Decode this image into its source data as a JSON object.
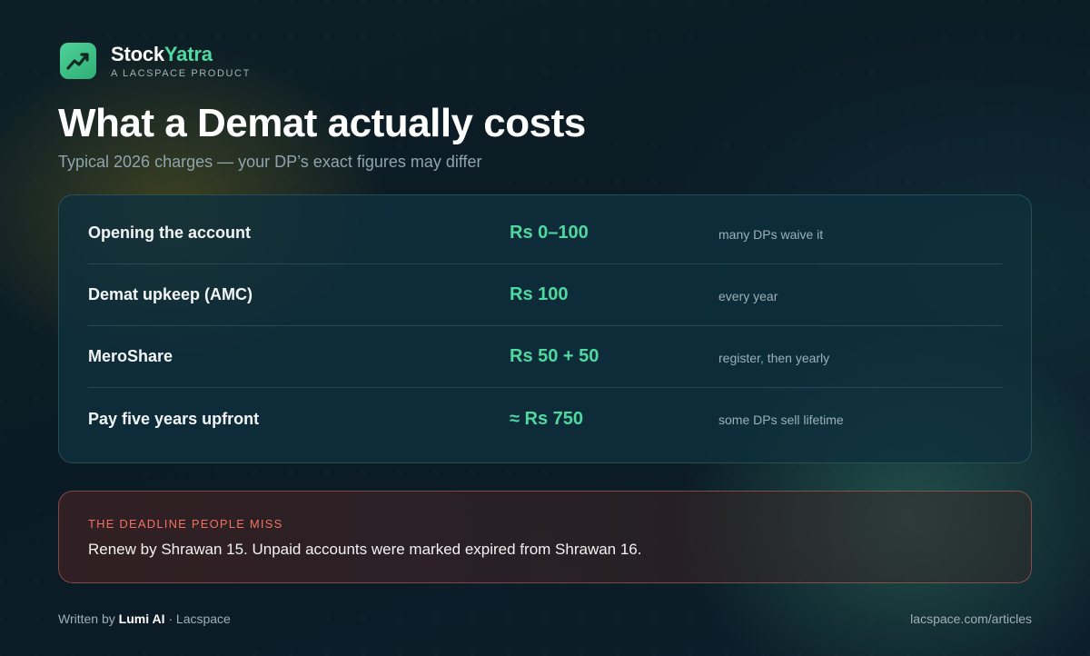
{
  "brand": {
    "name_part1": "Stock",
    "name_part2": "Yatra",
    "tagline": "A LACSPACE PRODUCT",
    "icon": "trend-up-icon",
    "accent_color": "#4fd9a0"
  },
  "title": "What a Demat actually costs",
  "subtitle": "Typical 2026 charges — your DP’s exact figures may differ",
  "charges": [
    {
      "label": "Opening the account",
      "value": "Rs 0–100",
      "note": "many DPs waive it"
    },
    {
      "label": "Demat upkeep (AMC)",
      "value": "Rs 100",
      "note": "every year"
    },
    {
      "label": "MeroShare",
      "value": "Rs 50 + 50",
      "note": "register, then yearly"
    },
    {
      "label": "Pay five years upfront",
      "value": "≈ Rs 750",
      "note": "some DPs sell lifetime"
    }
  ],
  "alert": {
    "kicker": "THE DEADLINE PEOPLE MISS",
    "text": "Renew by Shrawan 15. Unpaid accounts were marked expired from Shrawan 16.",
    "color": "#f0735f"
  },
  "footer": {
    "written_by": "Written by",
    "author": "Lumi AI",
    "separator_org": "· Lacspace",
    "link": "lacspace.com/articles"
  }
}
